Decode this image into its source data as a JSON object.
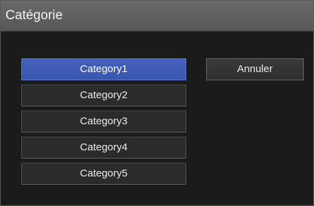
{
  "dialog": {
    "title": "Catégorie"
  },
  "categories": [
    {
      "label": "Category1",
      "selected": true
    },
    {
      "label": "Category2",
      "selected": false
    },
    {
      "label": "Category3",
      "selected": false
    },
    {
      "label": "Category4",
      "selected": false
    },
    {
      "label": "Category5",
      "selected": false
    }
  ],
  "buttons": {
    "cancel_label": "Annuler"
  },
  "colors": {
    "selected_accent": "#3f5bb7",
    "titlebar": "#606060",
    "background": "#1b1b1b"
  }
}
